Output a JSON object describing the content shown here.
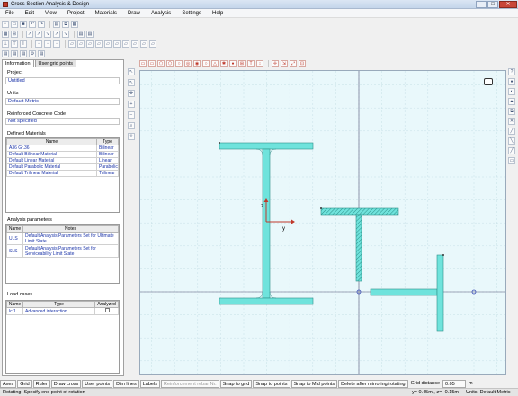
{
  "window": {
    "title": "Cross Section Analysis & Design"
  },
  "menu": [
    "File",
    "Edit",
    "View",
    "Project",
    "Materials",
    "Draw",
    "Analysis",
    "Settings",
    "Help"
  ],
  "tabs": [
    "Information",
    "User grid points"
  ],
  "project": {
    "label": "Project",
    "value": "Untitled"
  },
  "units": {
    "label": "Units",
    "value": "Default Metric"
  },
  "rc_code": {
    "label": "Reinforced Concrete Code",
    "value": "Not specified"
  },
  "materials": {
    "label": "Defined Materials",
    "headers": [
      "Name",
      "Type"
    ],
    "rows": [
      [
        "A36 Gr.36",
        "Bilinear"
      ],
      [
        "Default Bilinear Material",
        "Bilinear"
      ],
      [
        "Default Linear Material",
        "Linear"
      ],
      [
        "Default Parabolic Material",
        "Parabolic"
      ],
      [
        "Default Trilinear Material",
        "Trilinear"
      ]
    ]
  },
  "analysis": {
    "label": "Analysis parameters",
    "headers": [
      "Name",
      "Notes"
    ],
    "rows": [
      [
        "ULS",
        "Default Analysis Parameters Set for Ultimate Limit State"
      ],
      [
        "SLS",
        "Default Analysis Parameters Set for Serviceability Limit State"
      ]
    ]
  },
  "loads": {
    "label": "Load cases",
    "headers": [
      "Name",
      "Type",
      "Analyzed"
    ],
    "rows": [
      [
        "lc 1",
        "Advanced interaction",
        ""
      ]
    ]
  },
  "axes": {
    "z": "z",
    "y": "y"
  },
  "bottom_buttons": [
    "Axes",
    "Grid",
    "Ruler",
    "Draw cross",
    "User points",
    "Dim lines",
    "Labels",
    "Reinforcement rebar Nr.",
    "Snap to grid",
    "Snap to points",
    "Snap to Mid points",
    "Delete after mirroring/rotating"
  ],
  "grid_distance": {
    "label": "Grid distance",
    "value": "0.05",
    "unit": "m"
  },
  "status": {
    "message": "Rotating: Specify end point of rotation",
    "coords": "y= 0.45m , z= -0.15m",
    "units": "Units: Default Metric"
  },
  "colors": {
    "section_fill": "#6fe3dc",
    "section_stroke": "#2d8f89",
    "grid": "#c6dfe6",
    "axis": "#555577"
  }
}
